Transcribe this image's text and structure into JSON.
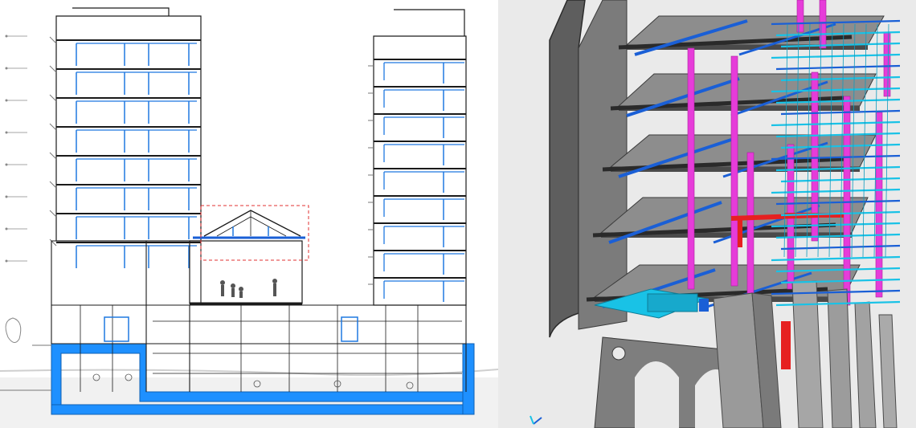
{
  "figure": {
    "left_panel": "section-drawing",
    "right_panel": "structural-3d-model"
  },
  "colors": {
    "drawing_line": "#1a1a1a",
    "drawing_blue": "#1f78e0",
    "foundation_blue": "#1e90ff",
    "highlight_red": "#e03030",
    "slab_gray": "#8d8d8d",
    "wall_gray": "#7f7f7f",
    "beam_blue": "#1a5fd6",
    "beam_cyan": "#19c2e6",
    "column_magenta": "#e63cd9",
    "beam_red": "#e62020",
    "background_model": "#eaeaea"
  },
  "icons": [
    "axis-triad-icon",
    "person-silhouette-icon"
  ]
}
